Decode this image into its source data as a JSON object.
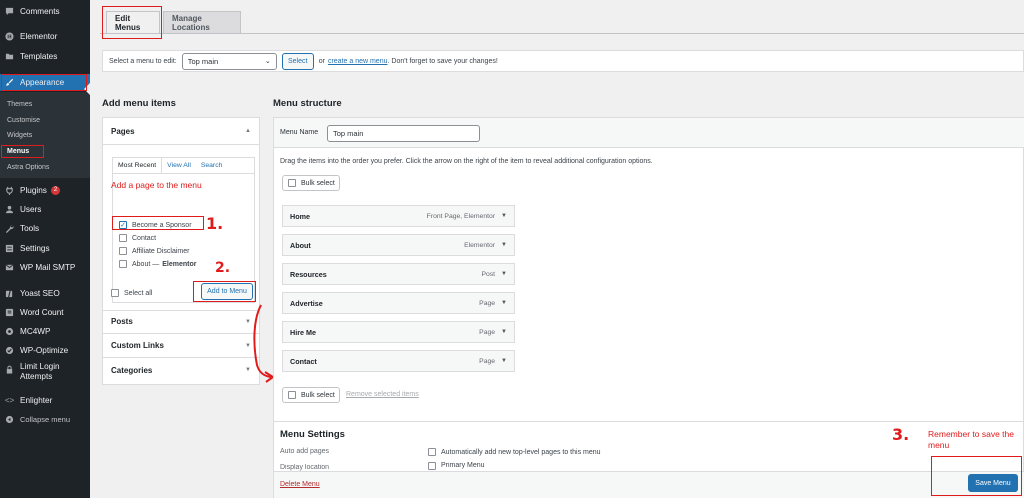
{
  "sidebar": {
    "items": [
      {
        "label": "Comments",
        "icon": "comment-icon"
      },
      {
        "label": "Elementor",
        "icon": "elementor-icon"
      },
      {
        "label": "Templates",
        "icon": "folder-icon"
      },
      {
        "label": "Appearance",
        "icon": "brush-icon"
      },
      {
        "label": "Plugins",
        "icon": "plugin-icon",
        "badge": "2"
      },
      {
        "label": "Users",
        "icon": "user-icon"
      },
      {
        "label": "Tools",
        "icon": "wrench-icon"
      },
      {
        "label": "Settings",
        "icon": "settings-icon"
      },
      {
        "label": "WP Mail SMTP",
        "icon": "mail-icon"
      },
      {
        "label": "Yoast SEO",
        "icon": "yoast-icon"
      },
      {
        "label": "Word Count",
        "icon": "word-count-icon"
      },
      {
        "label": "MC4WP",
        "icon": "mc4wp-icon"
      },
      {
        "label": "WP-Optimize",
        "icon": "optimize-icon"
      },
      {
        "label": "Limit Login",
        "label2": "Attempts",
        "icon": "lock-icon"
      },
      {
        "label": "Enlighter",
        "icon": "code-icon"
      },
      {
        "label": "Collapse menu",
        "icon": "collapse-icon"
      }
    ],
    "submenu": [
      "Themes",
      "Customise",
      "Widgets",
      "Menus",
      "Astra Options"
    ]
  },
  "tabs": {
    "edit": "Edit Menus",
    "locations": "Manage Locations"
  },
  "select_bar": {
    "label": "Select a menu to edit:",
    "selected": "Top main",
    "select_btn": "Select",
    "or": "or",
    "create_link": "create a new menu",
    "note": ". Don't forget to save your changes!"
  },
  "add_items": {
    "heading": "Add menu items",
    "pages_heading": "Pages",
    "subtabs": [
      "Most Recent",
      "View All",
      "Search"
    ],
    "pages": [
      {
        "label": "Become a Sponsor",
        "checked": true
      },
      {
        "label": "Contact",
        "checked": false
      },
      {
        "label": "Affiliate Disclaimer",
        "checked": false
      },
      {
        "label": "About —",
        "suffix": "Elementor",
        "checked": false
      }
    ],
    "select_all": "Select all",
    "add_btn": "Add to Menu",
    "sections": [
      "Posts",
      "Custom Links",
      "Categories"
    ]
  },
  "structure": {
    "heading": "Menu structure",
    "menu_name_label": "Menu Name",
    "menu_name_value": "Top main",
    "instructions": "Drag the items into the order you prefer. Click the arrow on the right of the item to reveal additional configuration options.",
    "bulk_select": "Bulk select",
    "remove_selected": "Remove selected items",
    "items": [
      {
        "title": "Home",
        "type": "Front Page, Elementor"
      },
      {
        "title": "About",
        "type": "Elementor"
      },
      {
        "title": "Resources",
        "type": "Post"
      },
      {
        "title": "Advertise",
        "type": "Page"
      },
      {
        "title": "Hire Me",
        "type": "Page"
      },
      {
        "title": "Contact",
        "type": "Page"
      }
    ],
    "settings_heading": "Menu Settings",
    "auto_add_label": "Auto add pages",
    "auto_add_text": "Automatically add new top-level pages to this menu",
    "display_location_label": "Display location",
    "display_location_option": "Primary Menu",
    "delete_menu": "Delete Menu",
    "save_menu": "Save Menu"
  },
  "annotations": {
    "add_page": "Add a page to the menu",
    "step1": "1.",
    "step2": "2.",
    "step3": "3.",
    "remember_line1": "Remember to save the",
    "remember_line2": "menu"
  },
  "colors": {
    "accent": "#2271b1",
    "sidebar": "#1d2327",
    "annotation": "#e01b1b"
  }
}
